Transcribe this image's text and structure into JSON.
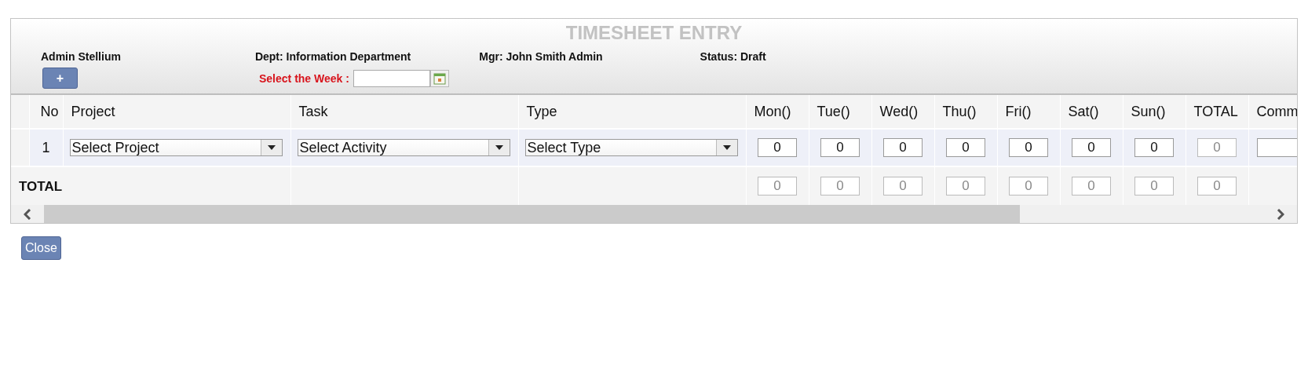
{
  "header": {
    "title": "TIMESHEET ENTRY",
    "employee": "Admin Stellium",
    "dept": "Dept: Information Department",
    "manager": "Mgr: John Smith Admin",
    "status": "Status: Draft",
    "add_button": "+",
    "week_label": "Select the Week :"
  },
  "table": {
    "columns": [
      "No",
      "Project",
      "Task",
      "Type",
      "Mon()",
      "Tue()",
      "Wed()",
      "Thu()",
      "Fri()",
      "Sat()",
      "Sun()",
      "TOTAL",
      "Comm"
    ],
    "rows": [
      {
        "no": "1",
        "project": "Select Project",
        "task": "Select Activity",
        "type": "Select Type",
        "hours": [
          {
            "value": "0",
            "disabled": false
          },
          {
            "value": "0",
            "disabled": false
          },
          {
            "value": "0",
            "disabled": false
          },
          {
            "value": "0",
            "disabled": false
          },
          {
            "value": "0",
            "disabled": false
          },
          {
            "value": "0",
            "disabled": false
          },
          {
            "value": "0",
            "disabled": false
          }
        ],
        "total": {
          "value": "0",
          "disabled": true
        }
      }
    ],
    "total_row": {
      "label": "TOTAL",
      "hours": [
        {
          "value": "0",
          "disabled": true
        },
        {
          "value": "0",
          "disabled": true
        },
        {
          "value": "0",
          "disabled": true
        },
        {
          "value": "0",
          "disabled": true
        },
        {
          "value": "0",
          "disabled": true
        },
        {
          "value": "0",
          "disabled": true
        },
        {
          "value": "0",
          "disabled": true
        }
      ],
      "total": {
        "value": "0",
        "disabled": true
      }
    }
  },
  "close_button": "Close"
}
